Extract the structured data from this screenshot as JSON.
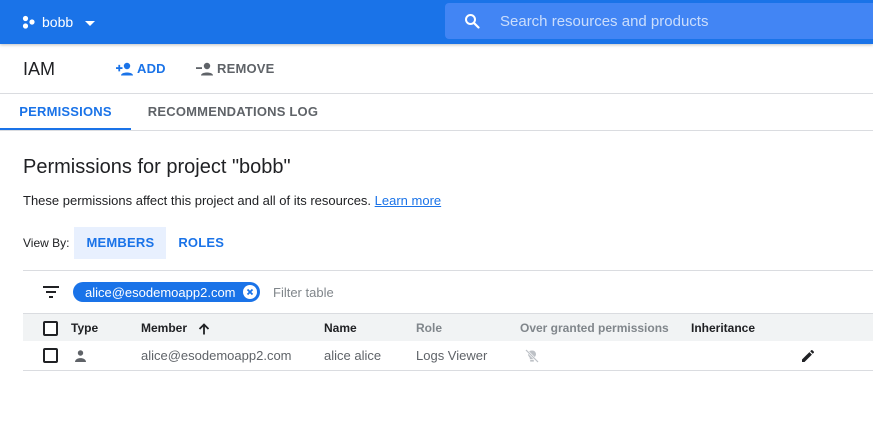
{
  "topbar": {
    "project_name": "bobb",
    "search_placeholder": "Search resources and products",
    "colors": {
      "bar": "#1a73e8",
      "search_bg": "#4285f4"
    }
  },
  "actionbar": {
    "title": "IAM",
    "add_label": "ADD",
    "remove_label": "REMOVE"
  },
  "tabs": [
    {
      "label": "PERMISSIONS",
      "active": true
    },
    {
      "label": "RECOMMENDATIONS LOG",
      "active": false
    }
  ],
  "content": {
    "heading": "Permissions for project \"bobb\"",
    "description": "These permissions affect this project and all of its resources.",
    "learn_more": "Learn more",
    "view_by_label": "View By:",
    "view_by_options": [
      {
        "label": "MEMBERS",
        "active": true
      },
      {
        "label": "ROLES",
        "active": false
      }
    ]
  },
  "filter": {
    "chip": "alice@esodemoapp2.com",
    "placeholder": "Filter table"
  },
  "table": {
    "columns": {
      "type": "Type",
      "member": "Member",
      "name": "Name",
      "role": "Role",
      "over_granted": "Over granted permissions",
      "inheritance": "Inheritance"
    },
    "sort": {
      "column": "member",
      "direction": "ascending"
    },
    "rows": [
      {
        "type_icon": "person-icon",
        "member": "alice@esodemoapp2.com",
        "name": "alice alice",
        "role": "Logs Viewer",
        "over_granted_icon": "lightbulb-off-icon",
        "inheritance": "",
        "action_icon": "edit-pencil-icon"
      }
    ]
  }
}
